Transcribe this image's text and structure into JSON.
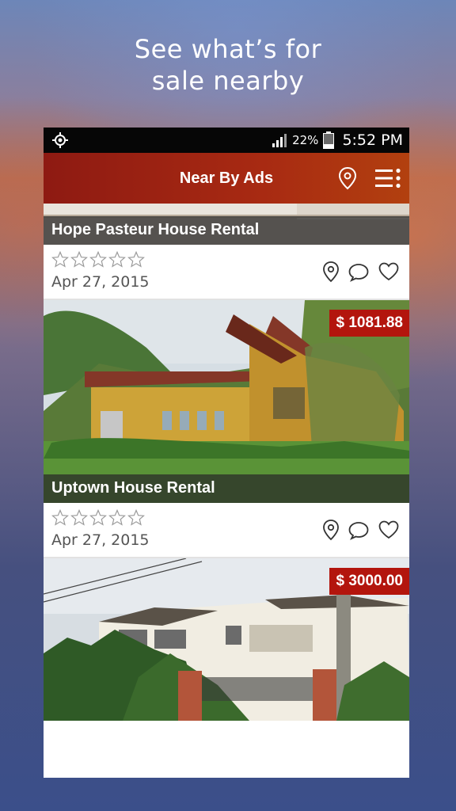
{
  "promo": {
    "line1": "See what’s for",
    "line2": "sale nearby"
  },
  "status_bar": {
    "battery_percent": "22%",
    "time": "5:52 PM"
  },
  "app_bar": {
    "title": "Near By Ads"
  },
  "listings": [
    {
      "title": "Hope Pasteur House Rental",
      "rating": 0,
      "date": "Apr 27, 2015"
    },
    {
      "title": "Uptown House Rental",
      "price": "$ 1081.88",
      "rating": 0,
      "date": "Apr 27, 2015"
    },
    {
      "price": "$ 3000.00"
    }
  ],
  "icons": {
    "status_left": "gps-icon",
    "app_bar": [
      "location-pin-icon",
      "menu-icon"
    ],
    "listing_actions": [
      "location-pin-icon",
      "comment-icon",
      "heart-icon"
    ]
  },
  "colors": {
    "app_bar": "#a32512",
    "price_tag": "#b3150d",
    "caption_overlay": "#282828"
  }
}
